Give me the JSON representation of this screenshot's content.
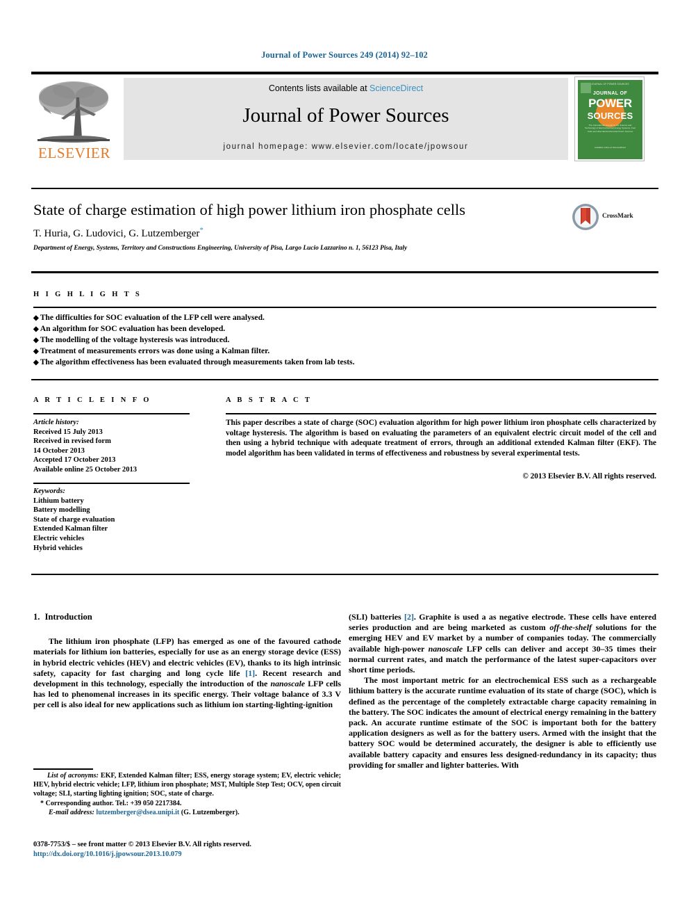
{
  "running_head": "Journal of Power Sources 249 (2014) 92–102",
  "masthead": {
    "contents_prefix": "Contents lists available at ",
    "sciencedirect": "ScienceDirect",
    "journal_title": "Journal of Power Sources",
    "homepage": "journal homepage: www.elsevier.com/locate/jpowsour",
    "publisher_wordmark": "ELSEVIER",
    "publisher_logo_icon": "elsevier-tree-icon",
    "accent_orange": "#e87722",
    "link_blue": "#3a8fbf",
    "banner_bg": "#e4e4e4"
  },
  "cover": {
    "top_line": "JOURNAL OF POWER SOURCES",
    "journal_of": "JOURNAL OF",
    "power": "POWER",
    "sources": "SOURCES",
    "blurb": "The International Journal on the Science and Technology of Electrochemical Energy Systems, Fuel Cells and other Electrochemical Power Sources",
    "footer": "Available online at\nScienceDirect",
    "bg_green": "#3f8a3f",
    "sun_orange": "#e8882a"
  },
  "article": {
    "title": "State of charge estimation of high power lithium iron phosphate cells",
    "authors": "T. Huria, G. Ludovici, G. Lutzemberger",
    "corresponding_marker": "*",
    "affiliation": "Department of Energy, Systems, Territory and Constructions Engineering, University of Pisa, Largo Lucio Lazzarino n. 1, 56123 Pisa, Italy",
    "crossmark_label": "CrossMark",
    "crossmark_icon": "crossmark-badge-icon"
  },
  "highlights": {
    "label": "H I G H L I G H T S",
    "items": [
      "The difficulties for SOC evaluation of the LFP cell were analysed.",
      "An algorithm for SOC evaluation has been developed.",
      "The modelling of the voltage hysteresis was introduced.",
      "Treatment of measurements errors was done using a Kalman filter.",
      "The algorithm effectiveness has been evaluated through measurements taken from lab tests."
    ]
  },
  "article_info": {
    "label": "A R T I C L E   I N F O",
    "history_heading": "Article history:",
    "history": [
      "Received 15 July 2013",
      "Received in revised form",
      "14 October 2013",
      "Accepted 17 October 2013",
      "Available online 25 October 2013"
    ],
    "keywords_heading": "Keywords:",
    "keywords": [
      "Lithium battery",
      "Battery modelling",
      "State of charge evaluation",
      "Extended Kalman filter",
      "Electric vehicles",
      "Hybrid vehicles"
    ]
  },
  "abstract": {
    "label": "A B S T R A C T",
    "text": "This paper describes a state of charge (SOC) evaluation algorithm for high power lithium iron phosphate cells characterized by voltage hysteresis. The algorithm is based on evaluating the parameters of an equivalent electric circuit model of the cell and then using a hybrid technique with adequate treatment of errors, through an additional extended Kalman filter (EKF). The model algorithm has been validated in terms of effectiveness and robustness by several experimental tests.",
    "copyright": "© 2013 Elsevier B.V. All rights reserved."
  },
  "body": {
    "section_number": "1.",
    "section_title": "Introduction",
    "left_paragraph_1a": "The lithium iron phosphate (LFP) has emerged as one of the favoured cathode materials for lithium ion batteries, especially for use as an energy storage device (ESS) in hybrid electric vehicles (HEV) and electric vehicles (EV), thanks to its high intrinsic safety, capacity for fast charging and long cycle life ",
    "left_ref_1": "[1]",
    "left_paragraph_1b": ". Recent research and development in this technology, especially the introduction of the ",
    "left_italic_1": "nanoscale",
    "left_paragraph_1c": " LFP cells has led to phenomenal increases in its specific energy. Their voltage balance of 3.3 V per cell is also ideal for new applications such as lithium ion starting-lighting-ignition",
    "right_paragraph_1a": "(SLI) batteries ",
    "right_ref_2": "[2]",
    "right_paragraph_1b": ". Graphite is used a as negative electrode. These cells have entered series production and are being marketed as custom ",
    "right_italic_1": "off-the-shelf",
    "right_paragraph_1c": " solutions for the emerging HEV and EV market by a number of companies today. The commercially available high-power ",
    "right_italic_2": "nanoscale",
    "right_paragraph_1d": " LFP cells can deliver and accept 30–35 times their normal current rates, and match the performance of the latest super-capacitors over short time periods.",
    "right_paragraph_2": "The most important metric for an electrochemical ESS such as a rechargeable lithium battery is the accurate runtime evaluation of its state of charge (SOC), which is defined as the percentage of the completely extractable charge capacity remaining in the battery. The SOC indicates the amount of electrical energy remaining in the battery pack. An accurate runtime estimate of the SOC is important both for the battery application designers as well as for the battery users. Armed with the insight that the battery SOC would be determined accurately, the designer is able to efficiently use available battery capacity and ensures less designed-redundancy in its capacity; thus providing for smaller and lighter batteries. With"
  },
  "footnotes": {
    "acronyms_heading": "List of acronyms:",
    "acronyms_text": " EKF, Extended Kalman filter; ESS, energy storage system; EV, electric vehicle; HEV, hybrid electric vehicle; LFP, lithium iron phosphate; MST, Multiple Step Test; OCV, open circuit voltage; SLI, starting lighting ignition; SOC, state of charge.",
    "corresponding": "* Corresponding author. Tel.: +39 050 2217384.",
    "email_heading": "E-mail address:",
    "email": "lutzemberger@dsea.unipi.it",
    "email_suffix": " (G. Lutzemberger).",
    "issn_line": "0378-7753/$ – see front matter © 2013 Elsevier B.V. All rights reserved.",
    "doi": "http://dx.doi.org/10.1016/j.jpowsour.2013.10.079"
  }
}
